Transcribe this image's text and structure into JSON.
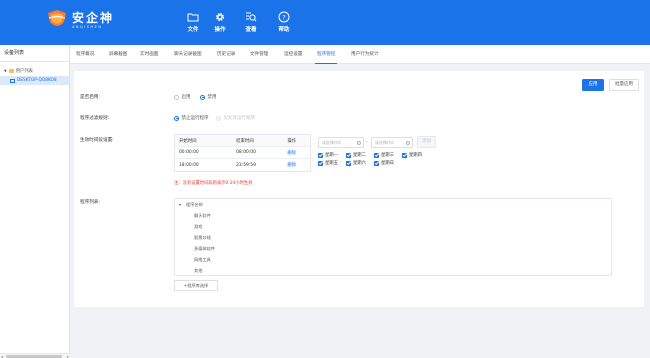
{
  "header": {
    "logo_cn": "安企神",
    "logo_en": "ANQISHEN",
    "nav": [
      {
        "label": "文件",
        "icon": "folder-icon"
      },
      {
        "label": "操作",
        "icon": "gear-icon"
      },
      {
        "label": "查看",
        "icon": "view-search-icon"
      },
      {
        "label": "帮助",
        "icon": "help-icon"
      }
    ]
  },
  "sidebar": {
    "title": "设备列表",
    "tree": [
      {
        "label": "用户列表",
        "expanded": true
      },
      {
        "label": "DESKTOP-QO8KO8",
        "selected": true
      }
    ]
  },
  "tabs": [
    "程序概况",
    "屏幕截图",
    "实时画面",
    "聊天记录截图",
    "历史记录",
    "文件管理",
    "运控设置",
    "程序管控",
    "用户行为统计"
  ],
  "active_tab": 7,
  "actions": {
    "apply": "应用",
    "batch_apply": "批量应用"
  },
  "enable": {
    "label": "是否启用:",
    "options": [
      "启用",
      "禁用"
    ],
    "selected": 1
  },
  "filter": {
    "label": "程序过滤规则:",
    "options": [
      "禁止运行程序",
      "仅允许运行程序"
    ],
    "selected": 0
  },
  "schedule": {
    "label": "生效时间段设置:",
    "columns": [
      "开始时间",
      "结束时间",
      "操作"
    ],
    "rows": [
      {
        "start": "00:00:00",
        "end": "08:00:00",
        "action": "删除"
      },
      {
        "start": "18:00:00",
        "end": "23:59:59",
        "action": "删除"
      }
    ],
    "start_placeholder": "请选择时间",
    "end_placeholder": "请选择时间",
    "separator": "-",
    "add_button": "添加",
    "weekdays": [
      "星期一",
      "星期二",
      "星期三",
      "星期四",
      "星期五",
      "星期六",
      "星期日"
    ],
    "note": "注：没有设置时间段则表示0-24小时生效"
  },
  "programs": {
    "label": "程序列表:",
    "root": "程序名称",
    "items": [
      "聊天软件",
      "游戏",
      "股票炒线",
      "多媒体软件",
      "网络工具",
      "其他"
    ],
    "add_button": "+程序库选择"
  }
}
